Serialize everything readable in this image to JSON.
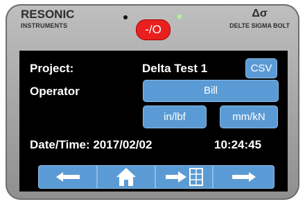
{
  "header": {
    "brand_left_line1": "RESONIC",
    "brand_left_line2": "INSTRUMENTS",
    "brand_right_symbol": "Δσ",
    "brand_right_line2": "DELTE SIGMA BOLT",
    "power_label": "-/O"
  },
  "form": {
    "project_label": "Project:",
    "project_value": "Delta Test 1",
    "csv_label": "CSV",
    "operator_label": "Operator",
    "operator_value": "Bill",
    "unit_imperial": "in/lbf",
    "unit_metric": "mm/kN",
    "datetime_label": "Date/Time: 2017/02/02",
    "time_value": "10:24:45"
  },
  "nav": {
    "buttons": [
      "back-arrow-icon",
      "home-icon",
      "arrow-to-grid-icon",
      "forward-arrow-icon"
    ]
  },
  "colors": {
    "button": "#5b9bd5",
    "power": "#e8201f",
    "screen": "#000000",
    "led_on": "#b8f0a8"
  }
}
